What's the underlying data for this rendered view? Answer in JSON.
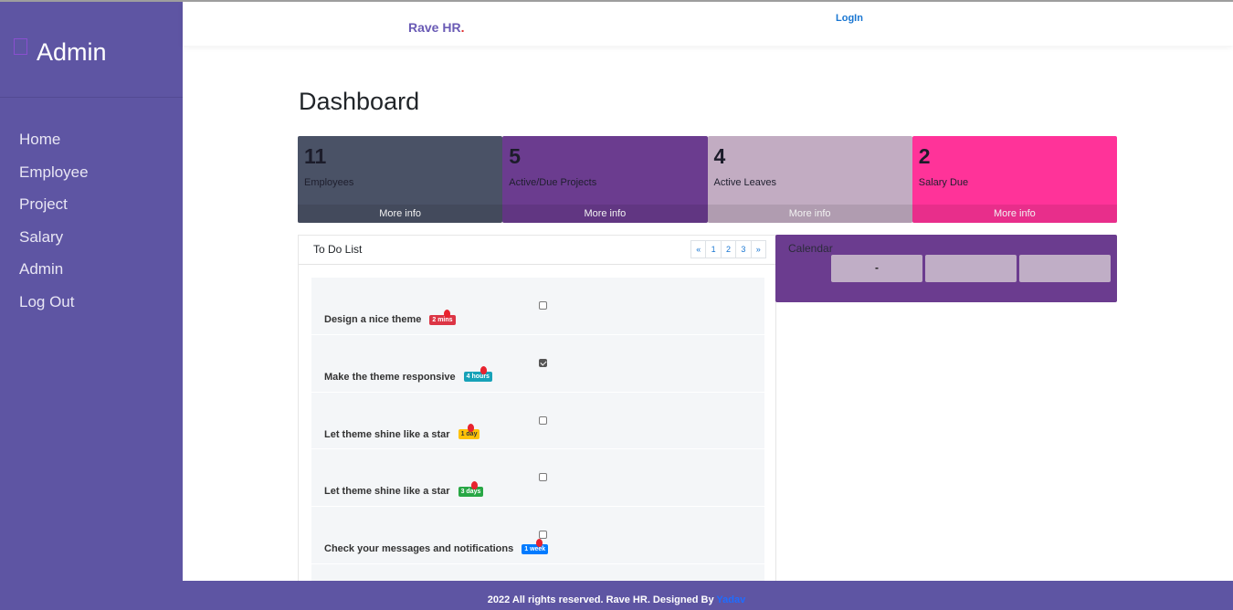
{
  "sidebar": {
    "brand_icon": "dashboard-icon",
    "title": "Admin",
    "items": [
      {
        "label": "Home"
      },
      {
        "label": "Employee"
      },
      {
        "label": "Project"
      },
      {
        "label": "Salary"
      },
      {
        "label": "Admin"
      },
      {
        "label": "Log Out"
      }
    ]
  },
  "header": {
    "brand": "Rave HR",
    "brand_dot": ".",
    "login": "LogIn"
  },
  "main": {
    "title": "Dashboard",
    "stats": [
      {
        "value": "11",
        "label": "Employees",
        "more": "More info",
        "color": "#4a5266"
      },
      {
        "value": "5",
        "label": "Active/Due Projects",
        "more": "More info",
        "color": "#6b3c8f"
      },
      {
        "value": "4",
        "label": "Active Leaves",
        "more": "More info",
        "color": "#c2acc2"
      },
      {
        "value": "2",
        "label": "Salary Due",
        "more": "More info",
        "color": "#ff3399"
      }
    ],
    "todo": {
      "title": "To Do List",
      "pagination": [
        "«",
        "1",
        "2",
        "3",
        "»"
      ],
      "items": [
        {
          "text": "Design a nice theme",
          "badge": "2 mins",
          "badge_color": "#dc3545",
          "checked": false
        },
        {
          "text": "Make the theme responsive",
          "badge": "4 hours",
          "badge_color": "#17a2b8",
          "checked": true
        },
        {
          "text": "Let theme shine like a star",
          "badge": "1 day",
          "badge_color": "#ffc107",
          "checked": false
        },
        {
          "text": "Let theme shine like a star",
          "badge": "3 days",
          "badge_color": "#28a745",
          "checked": false
        },
        {
          "text": "Check your messages and notifications",
          "badge": "1 week",
          "badge_color": "#007bff",
          "checked": false
        }
      ]
    },
    "calendar": {
      "title": "Calendar",
      "buttons": [
        "-",
        "",
        ""
      ]
    }
  },
  "footer": {
    "text": "2022 All rights reserved. Rave HR. Designed By ",
    "link": "Yadav"
  }
}
